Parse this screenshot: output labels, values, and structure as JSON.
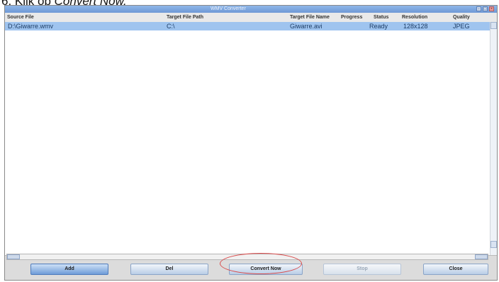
{
  "caption": {
    "prefix": "6. Klik op ",
    "command": "Convert Now."
  },
  "window": {
    "title": "WMV Converter",
    "buttons": {
      "minimize": "-",
      "maximize": "□",
      "close": "×"
    }
  },
  "table": {
    "columns": [
      "Source File",
      "Target File Path",
      "Target File Name",
      "Progress",
      "Status",
      "Resolution",
      "Quality"
    ],
    "rows": [
      {
        "source": "D:\\Giwarre.wmv",
        "path": "C:\\",
        "name": "Giwarre.avi",
        "progress": "",
        "status": "Ready",
        "resolution": "128x128",
        "quality": "JPEG"
      }
    ]
  },
  "actions": {
    "add": "Add",
    "del": "Del",
    "convert": "Convert Now",
    "stop": "Stop",
    "close": "Close"
  }
}
